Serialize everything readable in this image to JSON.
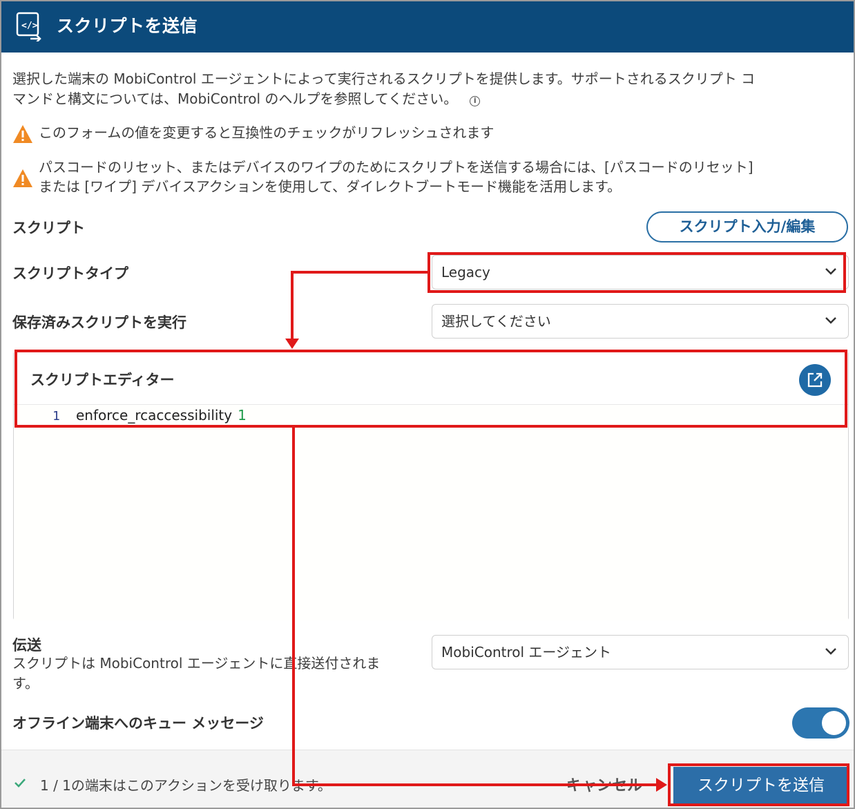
{
  "header": {
    "title": "スクリプトを送信",
    "icon": "script-send-icon"
  },
  "description": {
    "line1": "選択した端末の MobiControl エージェントによって実行されるスクリプトを提供します。サポートされるスクリプト コ",
    "line2": "マンドと構文については、MobiControl のヘルプを参照してください。",
    "info_icon": "i"
  },
  "warnings": [
    {
      "text": "このフォームの値を変更すると互換性のチェックがリフレッシュされます"
    },
    {
      "line1": "パスコードのリセット、またはデバイスのワイプのためにスクリプトを送信する場合には、[パスコードのリセット]",
      "line2": "または [ワイプ] デバイスアクションを使用して、ダイレクトブートモード機能を活用します。"
    }
  ],
  "script_section": {
    "label": "スクリプト",
    "button_label": "スクリプト入力/編集"
  },
  "script_type": {
    "label": "スクリプトタイプ",
    "value": "Legacy"
  },
  "saved_script": {
    "label": "保存済みスクリプトを実行",
    "value": "選択してください"
  },
  "editor": {
    "title": "スクリプトエディター",
    "lines": [
      {
        "number": "1",
        "code": "enforce_rcaccessibility",
        "arg": "1"
      }
    ]
  },
  "transport": {
    "label": "伝送",
    "desc_line1": "スクリプトは MobiControl エージェントに直接送付されま",
    "desc_line2": "す。",
    "value": "MobiControl エージェント"
  },
  "queue": {
    "label": "オフライン端末へのキュー メッセージ",
    "enabled": true
  },
  "footer": {
    "status": "1 / 1の端末はこのアクションを受け取ります。",
    "cancel_label": "キャンセル",
    "submit_label": "スクリプトを送信"
  },
  "colors": {
    "header": "#0c4a7b",
    "primary": "#2c6ea8",
    "annotation": "#e01919",
    "warning": "#f08a24"
  }
}
